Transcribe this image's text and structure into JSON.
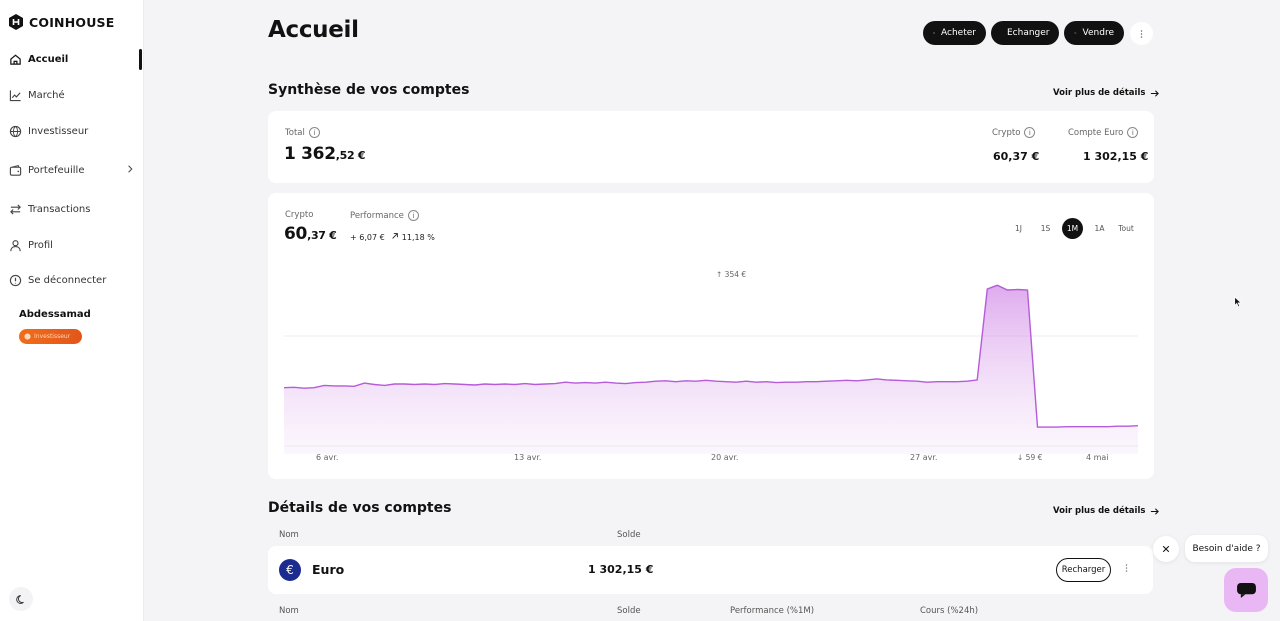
{
  "brand": {
    "name": "COINHOUSE"
  },
  "sidebar": {
    "items": [
      {
        "label": "Accueil",
        "icon": "home-icon"
      },
      {
        "label": "Marché",
        "icon": "chart-line-icon"
      },
      {
        "label": "Investisseur",
        "icon": "globe-icon"
      },
      {
        "label": "Portefeuille",
        "icon": "wallet-icon"
      },
      {
        "label": "Transactions",
        "icon": "arrows-swap-icon"
      },
      {
        "label": "Profil",
        "icon": "user-icon"
      },
      {
        "label": "Se déconnecter",
        "icon": "info-circle-icon"
      }
    ],
    "user_name": "Abdessamad",
    "user_badge": "Investisseur"
  },
  "header": {
    "title": "Accueil",
    "buttons": {
      "buy": "Acheter",
      "exchange": "Echanger",
      "sell": "Vendre"
    }
  },
  "summary": {
    "title": "Synthèse de vos comptes",
    "more_link": "Voir plus de détails",
    "total_label": "Total",
    "total_int": "1 362",
    "total_dec": ",52 €",
    "crypto_label": "Crypto",
    "crypto_value": "60,37 €",
    "euro_label": "Compte Euro",
    "euro_value": "1 302,15 €"
  },
  "crypto_card": {
    "label": "Crypto",
    "value_int": "60",
    "value_dec": ",37 €",
    "performance_label": "Performance",
    "performance_abs": "+ 6,07 €",
    "performance_pct": "11,18 %",
    "periods": [
      "1J",
      "1S",
      "1M",
      "1A",
      "Tout"
    ],
    "selected_period": "1M",
    "max_label": "354 €",
    "min_label": "59 €"
  },
  "chart_data": {
    "type": "area",
    "x_ticks": [
      "6 avr.",
      "13 avr.",
      "20 avr.",
      "27 avr.",
      "4 mai"
    ],
    "annotations": {
      "max": "354 €",
      "min": "59 €"
    },
    "values": [
      143,
      144,
      142,
      143,
      148,
      147,
      147,
      146,
      153,
      150,
      148,
      151,
      151,
      150,
      151,
      150,
      152,
      151,
      150,
      149,
      151,
      150,
      151,
      150,
      152,
      150,
      151,
      152,
      155,
      153,
      154,
      153,
      155,
      153,
      152,
      154,
      155,
      157,
      158,
      156,
      158,
      157,
      159,
      157,
      156,
      155,
      157,
      155,
      156,
      154,
      155,
      155,
      156,
      156,
      157,
      158,
      159,
      158,
      160,
      162,
      160,
      159,
      158,
      157,
      155,
      156,
      156,
      156,
      157,
      160,
      356,
      364,
      354,
      355,
      354,
      58,
      58,
      58,
      59,
      59,
      59,
      59,
      59,
      60,
      60,
      61
    ],
    "ylim": [
      0,
      410
    ],
    "grid": true,
    "color": "#b45cd9"
  },
  "accounts": {
    "title": "Détails de vos comptes",
    "more_link": "Voir plus de détails",
    "col_name": "Nom",
    "col_balance": "Solde",
    "euro_symbol": "€",
    "euro_name": "Euro",
    "euro_balance": "1 302,15 €",
    "recharge_label": "Recharger",
    "col_name2": "Nom",
    "col_balance2": "Solde",
    "col_perf": "Performance (%1M)",
    "col_rate": "Cours (%24h)"
  },
  "help": {
    "bubble": "Besoin d'aide ?"
  },
  "colors": {
    "accent": "#b45cd9",
    "dark": "#111111",
    "badge": "#f06d1b"
  }
}
